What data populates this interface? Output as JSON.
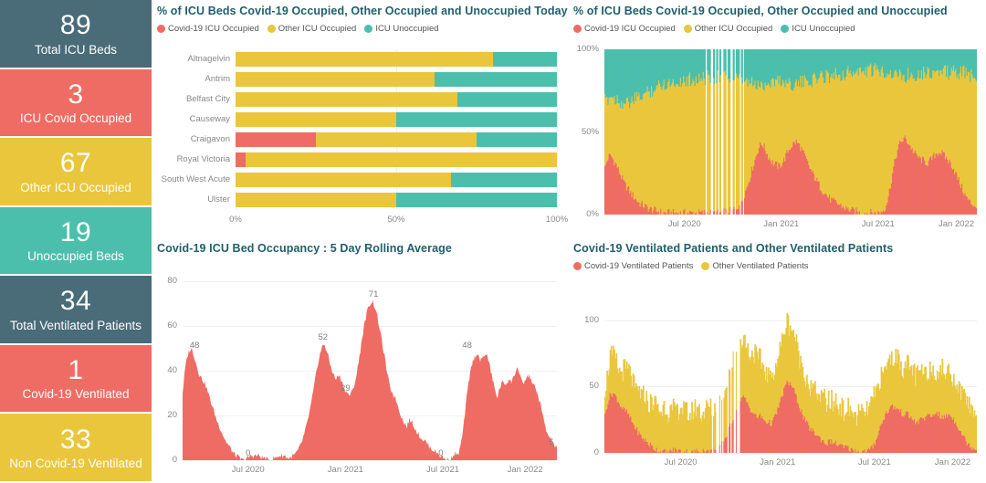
{
  "kpis": [
    {
      "name": "total-icu-beds",
      "value": "89",
      "label": "Total ICU Beds",
      "color": "#4a6b78",
      "text": "#ffffff"
    },
    {
      "name": "icu-covid-occupied",
      "value": "3",
      "label": "ICU Covid Occupied",
      "color": "#ee6c63",
      "text": "#ffffff"
    },
    {
      "name": "other-icu-occupied",
      "value": "67",
      "label": "Other ICU Occupied",
      "color": "#eac63c",
      "text": "#ffffff"
    },
    {
      "name": "unoccupied-beds",
      "value": "19",
      "label": "Unoccupied Beds",
      "color": "#4bbfac",
      "text": "#ffffff"
    },
    {
      "name": "total-ventilated-patients",
      "value": "34",
      "label": "Total Ventilated Patients",
      "color": "#4a6b78",
      "text": "#ffffff"
    },
    {
      "name": "covid-19-ventilated",
      "value": "1",
      "label": "Covid-19 Ventilated",
      "color": "#ee6c63",
      "text": "#ffffff"
    },
    {
      "name": "non-covid-19-ventilated",
      "value": "33",
      "label": "Non Covid-19 Ventilated",
      "color": "#eac63c",
      "text": "#ffffff"
    }
  ],
  "colors": {
    "covid": "#ee6c63",
    "other": "#eac63c",
    "unoccupied": "#4bbfac",
    "slate": "#4a6b78",
    "title": "#1f5f6b"
  },
  "panel_hbar": {
    "title": "% of ICU Beds Covid-19 Occupied, Other Occupied and Unoccupied Today",
    "legend": [
      {
        "label": "Covid-19 ICU Occupied",
        "color": "#ee6c63"
      },
      {
        "label": "Other ICU Occupied",
        "color": "#eac63c"
      },
      {
        "label": "ICU Unoccupied",
        "color": "#4bbfac"
      }
    ]
  },
  "panel_area_pct": {
    "title": "% of ICU Beds Covid-19 Occupied, Other Occupied and Unoccupied",
    "legend": [
      {
        "label": "Covid-19 ICU Occupied",
        "color": "#ee6c63"
      },
      {
        "label": "Other ICU Occupied",
        "color": "#eac63c"
      },
      {
        "label": "ICU Unoccupied",
        "color": "#4bbfac"
      }
    ]
  },
  "panel_rolling": {
    "title": "Covid-19 ICU Bed Occupancy : 5 Day Rolling Average"
  },
  "panel_vent": {
    "title": "Covid-19 Ventilated Patients and Other Ventilated Patients",
    "legend": [
      {
        "label": "Covid-19 Ventilated Patients",
        "color": "#ee6c63"
      },
      {
        "label": "Other Ventilated Patients",
        "color": "#eac63c"
      }
    ]
  },
  "chart_data": [
    {
      "id": "icu-beds-today-by-hospital",
      "type": "bar",
      "orientation": "horizontal",
      "stacked": true,
      "normalized": true,
      "title": "% of ICU Beds Covid-19 Occupied, Other Occupied and Unoccupied Today",
      "xlabel": "",
      "ylabel": "",
      "xlim": [
        0,
        100
      ],
      "xticks": [
        "0%",
        "50%",
        "100%"
      ],
      "xtick_values": [
        0,
        50,
        100
      ],
      "grid": true,
      "legend_position": "top",
      "categories": [
        "Altnagelvin",
        "Antrim",
        "Belfast City",
        "Causeway",
        "Craigavon",
        "Royal Victoria",
        "South West Acute",
        "Ulster"
      ],
      "series": [
        {
          "name": "Covid-19 ICU Occupied",
          "color": "#ee6c63",
          "values": [
            0,
            0,
            0,
            0,
            25,
            3,
            0,
            0
          ]
        },
        {
          "name": "Other ICU Occupied",
          "color": "#eac63c",
          "values": [
            80,
            62,
            69,
            50,
            50,
            97,
            67,
            50
          ]
        },
        {
          "name": "ICU Unoccupied",
          "color": "#4bbfac",
          "values": [
            20,
            38,
            31,
            50,
            25,
            0,
            33,
            50
          ]
        }
      ]
    },
    {
      "id": "icu-beds-pct-over-time",
      "type": "area",
      "stacked": true,
      "normalized": true,
      "title": "% of ICU Beds Covid-19 Occupied, Other Occupied and Unoccupied",
      "xlabel": "",
      "ylabel": "",
      "ylim": [
        0,
        100
      ],
      "yticks": [
        "0%",
        "50%",
        "100%"
      ],
      "ytick_values": [
        0,
        50,
        100
      ],
      "xticks": [
        "Jul 2020",
        "Jan 2021",
        "Jul 2021",
        "Jan 2022"
      ],
      "x_range": [
        "Apr 2020",
        "Mar 2022"
      ],
      "grid": false,
      "legend_position": "top",
      "series": [
        {
          "name": "Covid-19 ICU Occupied",
          "color": "#ee6c63"
        },
        {
          "name": "Other ICU Occupied",
          "color": "#eac63c"
        },
        {
          "name": "ICU Unoccupied",
          "color": "#4bbfac"
        }
      ],
      "covid_pct_samples": [
        28,
        34,
        36,
        33,
        30,
        26,
        22,
        18,
        16,
        13,
        11,
        9,
        7,
        6,
        5,
        4,
        3,
        3,
        2,
        2,
        1,
        1,
        1,
        1,
        1,
        1,
        1,
        1,
        1,
        1,
        1,
        1,
        1,
        1,
        1,
        1,
        1,
        1,
        1,
        1,
        1,
        1,
        2,
        2,
        2,
        3,
        4,
        6,
        9,
        13,
        18,
        24,
        30,
        36,
        41,
        43,
        40,
        36,
        33,
        31,
        30,
        29,
        31,
        34,
        38,
        41,
        43,
        44,
        42,
        39,
        35,
        31,
        27,
        24,
        21,
        18,
        15,
        13,
        11,
        9,
        8,
        7,
        6,
        5,
        4,
        3,
        3,
        2,
        2,
        1,
        1,
        1,
        1,
        1,
        1,
        1,
        1,
        2,
        4,
        9,
        18,
        28,
        36,
        42,
        45,
        46,
        44,
        41,
        38,
        36,
        34,
        33,
        32,
        31,
        33,
        35,
        37,
        38,
        37,
        35,
        33,
        31,
        28,
        24,
        20,
        16,
        12,
        9,
        7,
        6,
        5
      ],
      "unocc_pct_samples": [
        31,
        30,
        28,
        29,
        30,
        31,
        32,
        33,
        33,
        32,
        31,
        30,
        29,
        28,
        27,
        26,
        25,
        24,
        23,
        22,
        21,
        21,
        20,
        20,
        20,
        20,
        19,
        19,
        19,
        19,
        18,
        18,
        18,
        18,
        18,
        18,
        17,
        17,
        17,
        17,
        17,
        17,
        17,
        17,
        18,
        18,
        18,
        19,
        19,
        20,
        20,
        21,
        21,
        22,
        22,
        22,
        21,
        20,
        20,
        19,
        19,
        19,
        19,
        20,
        20,
        21,
        21,
        21,
        21,
        20,
        20,
        19,
        19,
        18,
        18,
        17,
        17,
        16,
        16,
        16,
        15,
        15,
        15,
        15,
        15,
        14,
        14,
        14,
        14,
        14,
        14,
        13,
        13,
        13,
        13,
        13,
        13,
        13,
        13,
        14,
        14,
        15,
        15,
        16,
        16,
        16,
        16,
        15,
        15,
        15,
        14,
        14,
        14,
        14,
        14,
        14,
        14,
        14,
        14,
        14,
        14,
        14,
        14,
        14,
        14,
        14,
        14,
        15,
        16,
        17,
        18
      ]
    },
    {
      "id": "covid-icu-occupancy-5-day-rolling-average",
      "type": "area",
      "title": "Covid-19 ICU Bed Occupancy : 5 Day Rolling Average",
      "xlabel": "",
      "ylabel": "",
      "ylim": [
        0,
        80
      ],
      "yticks": [
        "0",
        "20",
        "40",
        "60",
        "80"
      ],
      "ytick_values": [
        0,
        20,
        40,
        60,
        80
      ],
      "xticks": [
        "Jul 2020",
        "Jan 2021",
        "Jul 2021",
        "Jan 2022"
      ],
      "x_range": [
        "Apr 2020",
        "Mar 2022"
      ],
      "grid": true,
      "color": "#ee6c63",
      "annotations": [
        {
          "label": "48",
          "kind": "first-peak"
        },
        {
          "label": "0",
          "kind": "trough"
        },
        {
          "label": "52",
          "kind": "peak"
        },
        {
          "label": "29",
          "kind": "local-min"
        },
        {
          "label": "71",
          "kind": "max-peak"
        },
        {
          "label": "0",
          "kind": "trough"
        },
        {
          "label": "48",
          "kind": "peak"
        },
        {
          "label": "5",
          "kind": "last"
        }
      ],
      "samples": [
        30,
        42,
        48,
        50,
        47,
        42,
        38,
        36,
        34,
        30,
        26,
        22,
        18,
        15,
        12,
        9,
        7,
        5,
        3,
        2,
        1,
        0,
        0,
        1,
        2,
        2,
        2,
        2,
        1,
        1,
        0,
        0,
        1,
        1,
        2,
        2,
        2,
        1,
        1,
        2,
        3,
        5,
        8,
        12,
        17,
        23,
        30,
        38,
        45,
        50,
        52,
        48,
        43,
        39,
        36,
        38,
        36,
        32,
        30,
        29,
        31,
        36,
        43,
        52,
        60,
        66,
        70,
        71,
        68,
        62,
        55,
        48,
        40,
        33,
        30,
        28,
        24,
        20,
        17,
        15,
        18,
        17,
        14,
        12,
        10,
        9,
        8,
        6,
        5,
        4,
        3,
        2,
        1,
        0,
        0,
        1,
        3,
        2,
        6,
        14,
        26,
        36,
        43,
        46,
        48,
        44,
        46,
        48,
        44,
        38,
        32,
        28,
        33,
        35,
        34,
        36,
        35,
        38,
        42,
        37,
        34,
        36,
        38,
        36,
        33,
        30,
        26,
        20,
        14,
        11,
        9,
        7,
        5
      ]
    },
    {
      "id": "ventilated-patients-covid-and-other",
      "type": "area",
      "stacked": true,
      "title": "Covid-19 Ventilated Patients and Other Ventilated Patients",
      "xlabel": "",
      "ylabel": "",
      "ylim": [
        0,
        110
      ],
      "yticks": [
        "0",
        "50",
        "100"
      ],
      "ytick_values": [
        0,
        50,
        100
      ],
      "xticks": [
        "Jul 2020",
        "Jan 2021",
        "Jul 2021",
        "Jan 2022"
      ],
      "x_range": [
        "Apr 2020",
        "Mar 2022"
      ],
      "grid": true,
      "legend_position": "top",
      "series": [
        {
          "name": "Covid-19 Ventilated Patients",
          "color": "#ee6c63"
        },
        {
          "name": "Other Ventilated Patients",
          "color": "#eac63c"
        }
      ],
      "covid_samples": [
        28,
        38,
        44,
        45,
        42,
        38,
        34,
        32,
        30,
        26,
        22,
        18,
        15,
        12,
        10,
        8,
        6,
        4,
        3,
        2,
        1,
        1,
        0,
        1,
        2,
        2,
        2,
        1,
        1,
        1,
        0,
        0,
        1,
        1,
        2,
        2,
        1,
        1,
        1,
        2,
        3,
        5,
        8,
        12,
        17,
        23,
        29,
        35,
        40,
        42,
        40,
        36,
        32,
        29,
        27,
        28,
        26,
        24,
        23,
        22,
        25,
        30,
        36,
        43,
        50,
        53,
        52,
        48,
        42,
        36,
        30,
        25,
        21,
        18,
        16,
        14,
        12,
        10,
        8,
        7,
        9,
        8,
        7,
        6,
        5,
        4,
        4,
        3,
        2,
        2,
        1,
        1,
        1,
        1,
        2,
        4,
        8,
        14,
        20,
        26,
        30,
        33,
        35,
        34,
        33,
        31,
        29,
        30,
        28,
        26,
        24,
        22,
        25,
        27,
        26,
        28,
        27,
        29,
        31,
        28,
        26,
        27,
        29,
        28,
        25,
        22,
        18,
        14,
        10,
        7,
        5,
        4,
        3
      ],
      "other_samples": [
        18,
        26,
        30,
        28,
        26,
        24,
        28,
        30,
        32,
        34,
        30,
        28,
        32,
        30,
        34,
        32,
        30,
        34,
        36,
        32,
        30,
        34,
        32,
        30,
        28,
        32,
        30,
        34,
        32,
        30,
        28,
        30,
        32,
        34,
        30,
        28,
        32,
        34,
        30,
        32,
        34,
        36,
        38,
        40,
        42,
        44,
        46,
        48,
        46,
        44,
        42,
        40,
        44,
        46,
        44,
        42,
        40,
        38,
        36,
        34,
        36,
        38,
        40,
        42,
        44,
        46,
        44,
        42,
        40,
        38,
        36,
        34,
        32,
        30,
        32,
        34,
        30,
        32,
        34,
        30,
        28,
        30,
        32,
        30,
        28,
        26,
        28,
        30,
        28,
        26,
        28,
        30,
        28,
        30,
        32,
        34,
        36,
        38,
        36,
        34,
        36,
        38,
        36,
        38,
        40,
        38,
        36,
        34,
        36,
        38,
        36,
        34,
        36,
        34,
        32,
        34,
        36,
        34,
        32,
        34,
        36,
        34,
        32,
        34,
        32,
        30,
        32,
        30,
        34,
        32,
        30,
        28,
        32
      ]
    }
  ]
}
